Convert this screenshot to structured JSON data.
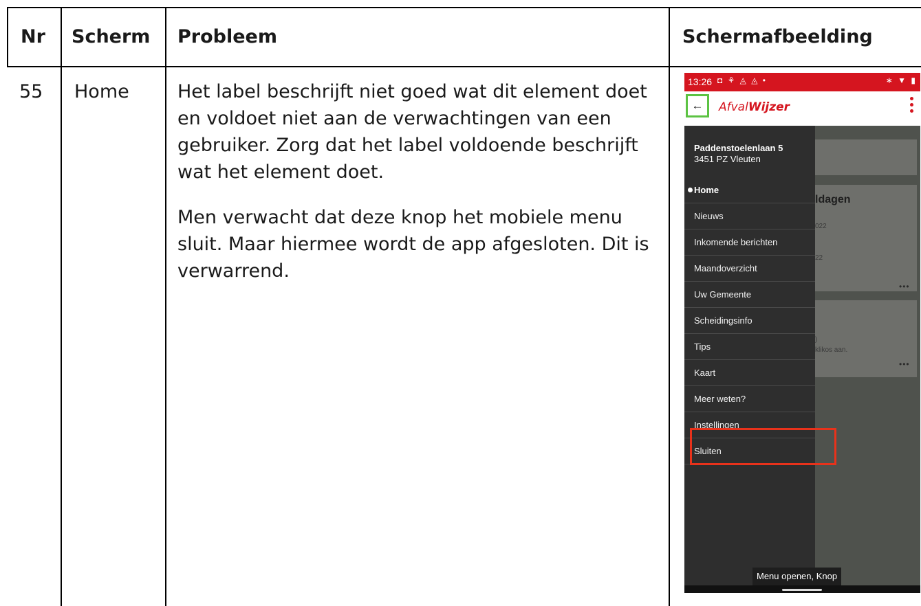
{
  "headers": {
    "nr": "Nr",
    "scherm": "Scherm",
    "probleem": "Probleem",
    "afbeelding": "Schermafbeelding"
  },
  "row": {
    "nr": "55",
    "scherm": "Home",
    "probleem_p1": "Het label beschrijft niet goed wat dit element doet en voldoet niet aan de verwachtingen van een gebruiker. Zorg dat het label voldoende beschrijft wat het element doet.",
    "probleem_p2": "Men verwacht dat deze knop het mobiele menu sluit. Maar hiermee wordt de app afgesloten. Dit is verwarrend."
  },
  "phone": {
    "status_time": "13:26",
    "status_icons": "◘ ⚘ ◬ ◬ •",
    "status_right": "∗ ▼ ▮",
    "back_icon": "←",
    "logo_prefix": "Afval",
    "logo_bold": "Wijzer",
    "address_line1": "Paddenstoelenlaan 5",
    "address_line2": "3451 PZ Vleuten",
    "menu": [
      "Home",
      "Nieuws",
      "Inkomende berichten",
      "Maandoverzicht",
      "Uw Gemeente",
      "Scheidingsinfo",
      "Tips",
      "Kaart",
      "Meer weten?",
      "Instellingen",
      "Sluiten"
    ],
    "active_item": "Home",
    "bg_heading": "ldagen",
    "bg_date1": "022",
    "bg_date2": "22",
    "bg_text": "klikos aan.",
    "bg_paren": ")",
    "tooltip": "Menu openen, Knop",
    "highlight_color": "#e8321b",
    "focus_color": "#5cc343",
    "brand_color": "#d5151f"
  }
}
